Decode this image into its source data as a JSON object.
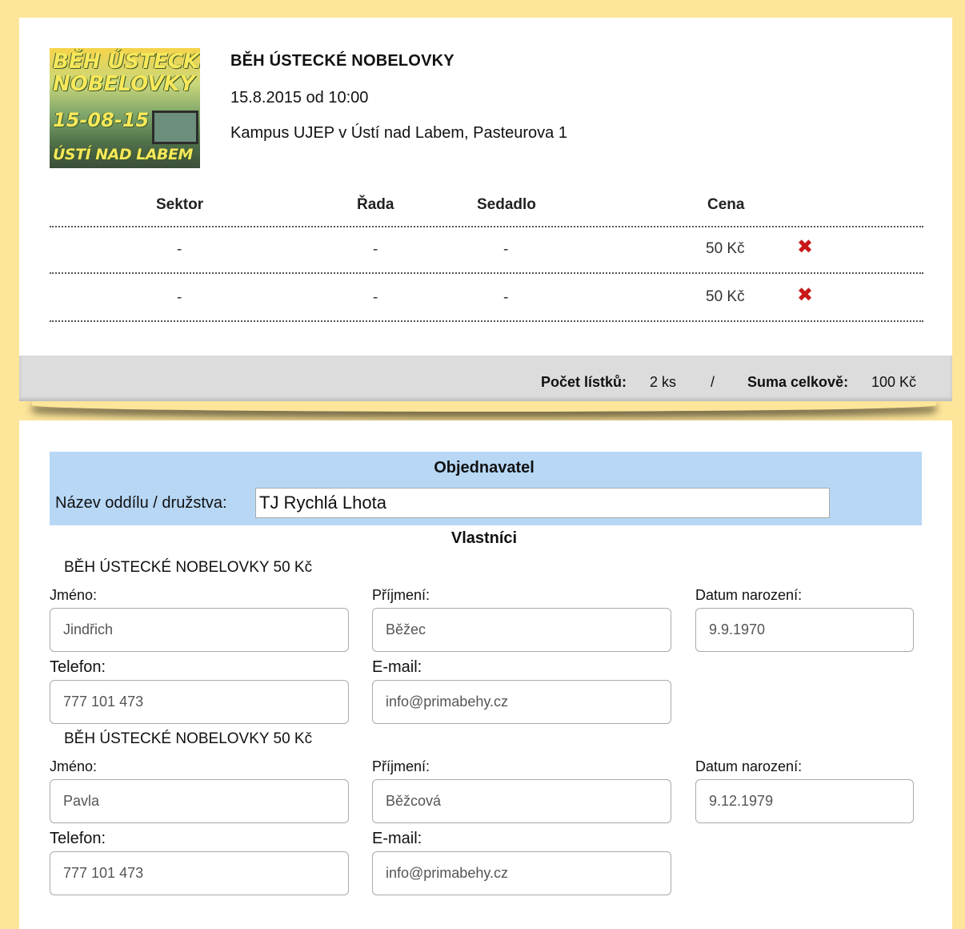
{
  "event": {
    "thumb_text": [
      "BĚH ÚSTECKÉ",
      "NOBELOVKY",
      "15-08-15",
      "ÚSTÍ NAD LABEM"
    ],
    "title": "BĚH ÚSTECKÉ NOBELOVKY",
    "date": "15.8.2015 od 10:00",
    "place": "Kampus UJEP v Ústí nad Labem, Pasteurova 1"
  },
  "tickets_table": {
    "headers": {
      "sector": "Sektor",
      "row": "Řada",
      "seat": "Sedadlo",
      "price": "Cena"
    },
    "rows": [
      {
        "sector": "-",
        "row": "-",
        "seat": "-",
        "price": "50 Kč"
      },
      {
        "sector": "-",
        "row": "-",
        "seat": "-",
        "price": "50 Kč"
      }
    ],
    "remove_icon": "close-icon"
  },
  "summary": {
    "count_label": "Počet lístků:",
    "count_value": "2 ks",
    "separator": "/",
    "total_label": "Suma celkově:",
    "total_value": "100 Kč"
  },
  "orderer": {
    "title": "Objednavatel",
    "team_label": "Název oddílu / družstva:",
    "team_value": "TJ Rychlá Lhota"
  },
  "owners": {
    "title": "Vlastníci",
    "labels": {
      "first_name": "Jméno:",
      "last_name": "Příjmení:",
      "birth_date": "Datum narození:",
      "phone": "Telefon:",
      "email": "E-mail:"
    },
    "list": [
      {
        "ticket": "BĚH ÚSTECKÉ NOBELOVKY 50 Kč",
        "first_name": "Jindřich",
        "last_name": "Běžec",
        "birth_date": "9.9.1970",
        "phone": "777 101 473",
        "email": "info@primabehy.cz"
      },
      {
        "ticket": "BĚH ÚSTECKÉ NOBELOVKY 50 Kč",
        "first_name": "Pavla",
        "last_name": "Běžcová",
        "birth_date": "9.12.1979",
        "phone": "777 101 473",
        "email": "info@primabehy.cz"
      }
    ]
  },
  "colors": {
    "outer_frame": "#fde59a",
    "panel_blue": "#b7d7f5",
    "remove_red": "#c81818"
  }
}
